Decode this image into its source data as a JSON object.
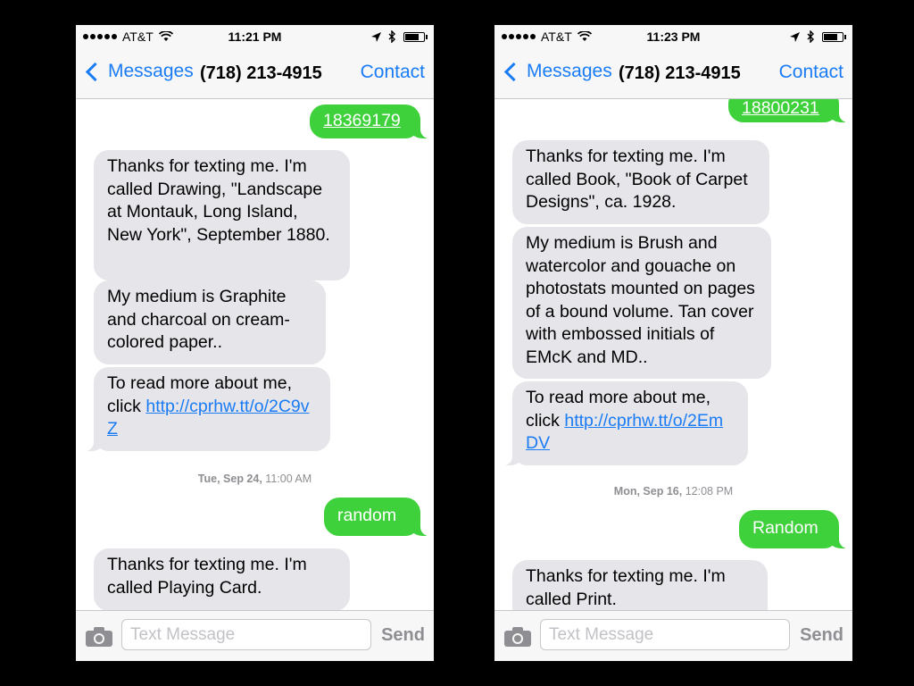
{
  "left": {
    "status": {
      "carrier": "AT&T",
      "time": "11:21 PM"
    },
    "nav": {
      "back_label": "Messages",
      "title": "(718) 213-4915",
      "contact_label": "Contact"
    },
    "messages": {
      "m1": "18369179",
      "m2": "Thanks for texting me. I'm called Drawing, \"Landscape at Montauk, Long Island, New York\", September 1880.",
      "m3": "My medium is Graphite and charcoal on cream-colored paper..",
      "m4_text": "To read more about me, click ",
      "m4_link": "http://cprhw.tt/o/2C9vZ",
      "timestamp_day": "Tue, Sep 24,",
      "timestamp_time": "11:00 AM",
      "m5": "random",
      "m6": "Thanks for texting me. I'm called Playing Card."
    },
    "input": {
      "placeholder": "Text Message",
      "send_label": "Send"
    }
  },
  "right": {
    "status": {
      "carrier": "AT&T",
      "time": "11:23 PM"
    },
    "nav": {
      "back_label": "Messages",
      "title": "(718) 213-4915",
      "contact_label": "Contact"
    },
    "messages": {
      "m1": "18800231",
      "m2": "Thanks for texting me. I'm called Book, \"Book of Carpet Designs\", ca. 1928.",
      "m3": "My medium is Brush and watercolor and gouache on photostats mounted on pages of a bound volume. Tan cover with embossed initials of EMcK and MD..",
      "m4_text": "To read more about me, click ",
      "m4_link": "http://cprhw.tt/o/2EmDV",
      "timestamp_day": "Mon, Sep 16,",
      "timestamp_time": "12:08 PM",
      "m5": "Random",
      "m6": "Thanks for texting me. I'm called Print."
    },
    "input": {
      "placeholder": "Text Message",
      "send_label": "Send"
    }
  },
  "icons": [
    "signal-icon",
    "wifi-icon",
    "location-arrow-icon",
    "bluetooth-icon",
    "battery-icon",
    "back-chevron-icon",
    "camera-icon"
  ],
  "colors": {
    "accent": "#1a7cf5",
    "sent_bubble": "#3fd13b",
    "received_bubble": "#e5e5ea",
    "bar_bg": "#f7f7f7"
  }
}
